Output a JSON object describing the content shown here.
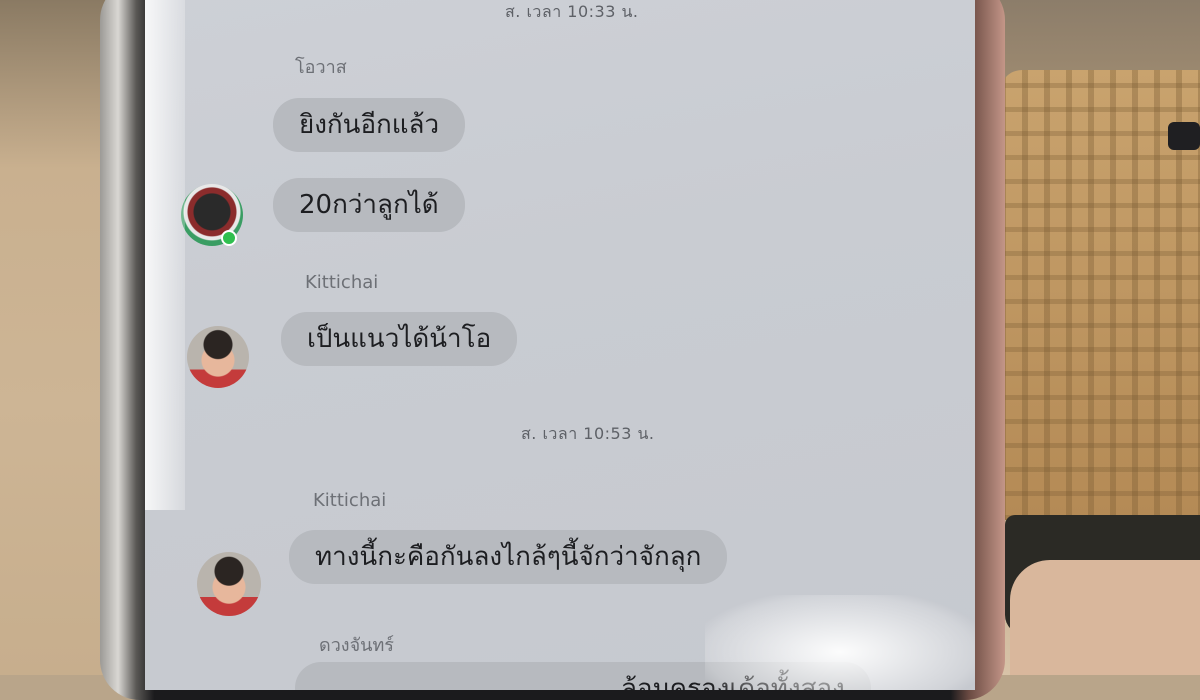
{
  "chat": {
    "timestamps": [
      "ส. เวลา 10:33 น.",
      "ส. เวลา 10:53 น."
    ],
    "messages": [
      {
        "sender": "โอวาส",
        "bubbles": [
          "ยิงกันอีกแล้ว",
          "20กว่าลูกได้"
        ]
      },
      {
        "sender": "Kittichai",
        "bubbles": [
          "เป็นแนวได้น้าโอ"
        ]
      },
      {
        "sender": "Kittichai",
        "bubbles": [
          "ทางนี้กะคือกันลงไกล้ๆนี้จักว่าจักลุก"
        ]
      },
      {
        "sender": "ดวงจันทร์",
        "bubbles": [
          "…ล้อมครองเด้อทั้งสอง"
        ]
      }
    ]
  },
  "icons": {
    "avatar_group": "group-avatar-icon",
    "avatar_person": "person-avatar-icon",
    "online_status": "online-status-icon"
  },
  "colors": {
    "bubble": "#b7babf",
    "screen": "#c9ccd2",
    "text": "#1d1e21",
    "timestamp": "#5e6167"
  }
}
